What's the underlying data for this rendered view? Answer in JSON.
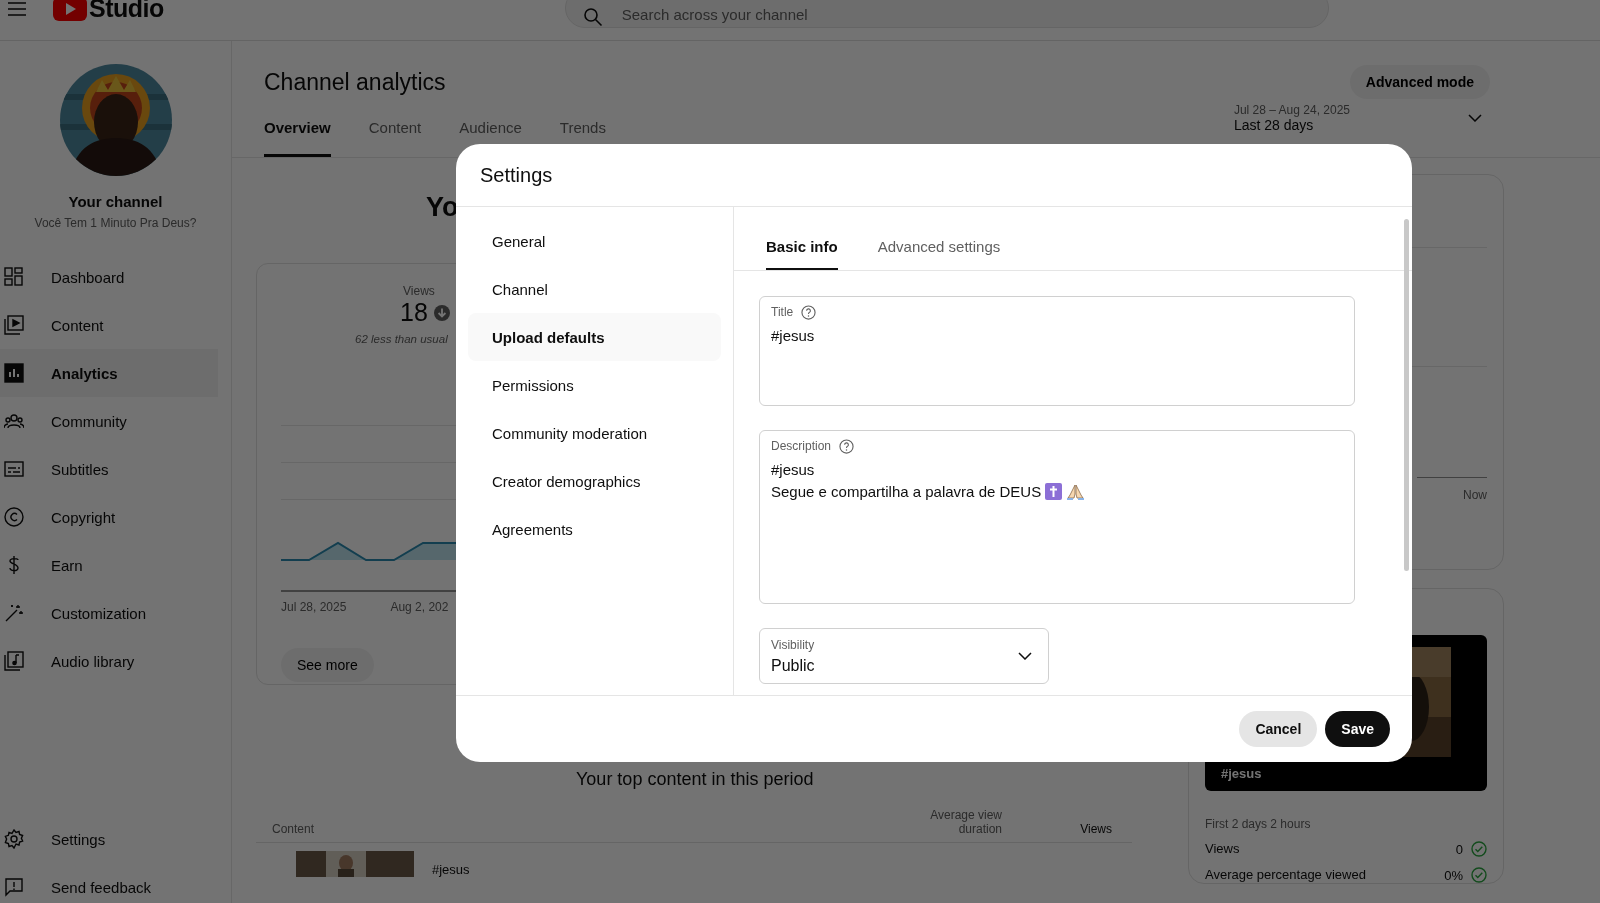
{
  "topbar": {
    "logo_text": "Studio",
    "search": {
      "placeholder": "Search across your channel"
    }
  },
  "sidebar": {
    "channel_title": "Your channel",
    "channel_name": "Você Tem 1 Minuto Pra Deus?",
    "items": [
      {
        "label": "Dashboard",
        "selected": false
      },
      {
        "label": "Content",
        "selected": false
      },
      {
        "label": "Analytics",
        "selected": true
      },
      {
        "label": "Community",
        "selected": false
      },
      {
        "label": "Subtitles",
        "selected": false
      },
      {
        "label": "Copyright",
        "selected": false
      },
      {
        "label": "Earn",
        "selected": false
      },
      {
        "label": "Customization",
        "selected": false
      },
      {
        "label": "Audio library",
        "selected": false
      }
    ],
    "footer_items": [
      {
        "label": "Settings"
      },
      {
        "label": "Send feedback"
      }
    ]
  },
  "page": {
    "title": "Channel analytics",
    "advanced_button": "Advanced mode",
    "tabs": [
      {
        "label": "Overview",
        "selected": true
      },
      {
        "label": "Content",
        "selected": false
      },
      {
        "label": "Audience",
        "selected": false
      },
      {
        "label": "Trends",
        "selected": false
      }
    ],
    "date_range": {
      "dates": "Jul 28 – Aug 24, 2025",
      "period": "Last 28 days"
    },
    "heading_fragment": "Yo",
    "views_card": {
      "label": "Views",
      "value": "18",
      "decreased": true,
      "comparison": "62 less than usual",
      "x_labels": [
        "Jul 28, 2025",
        "Aug 2, 202"
      ],
      "button": "See more"
    },
    "top_content": {
      "title": "Your top content in this period",
      "columns": [
        "Content",
        "Average view duration",
        "Views"
      ],
      "rows": [
        {
          "title": "#jesus"
        }
      ]
    },
    "realtime_card": {
      "axis_label": "Now"
    },
    "latest_card": {
      "thumbnail_label": "#jesus",
      "period": "First 2 days 2 hours",
      "metrics": [
        {
          "label": "Views",
          "value": "0",
          "ok": true
        },
        {
          "label": "Average percentage viewed",
          "value": "0%",
          "ok": true
        }
      ]
    }
  },
  "dialog": {
    "title": "Settings",
    "nav": [
      {
        "label": "General",
        "selected": false
      },
      {
        "label": "Channel",
        "selected": false
      },
      {
        "label": "Upload defaults",
        "selected": true
      },
      {
        "label": "Permissions",
        "selected": false
      },
      {
        "label": "Community moderation",
        "selected": false
      },
      {
        "label": "Creator demographics",
        "selected": false
      },
      {
        "label": "Agreements",
        "selected": false
      }
    ],
    "tabs": [
      {
        "label": "Basic info",
        "selected": true
      },
      {
        "label": "Advanced settings",
        "selected": false
      }
    ],
    "fields": [
      {
        "kind": "text",
        "label": "Title",
        "help": true,
        "lines": [
          "#jesus"
        ]
      },
      {
        "kind": "textarea",
        "label": "Description",
        "help": true,
        "lines": [
          "#jesus",
          "Segue e compartilha a palavra de DEUS"
        ]
      },
      {
        "kind": "select",
        "label": "Visibility",
        "help": false,
        "lines": [
          "Public"
        ]
      }
    ],
    "buttons": [
      {
        "label": "Cancel",
        "kind": "secondary"
      },
      {
        "label": "Save",
        "kind": "primary"
      }
    ]
  }
}
